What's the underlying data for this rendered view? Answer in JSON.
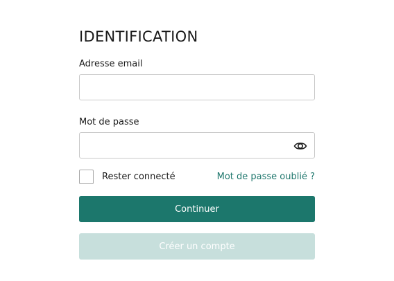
{
  "login": {
    "title": "IDENTIFICATION",
    "email_label": "Adresse email",
    "email_value": "",
    "password_label": "Mot de passe",
    "password_value": "",
    "show_password_icon": "eye-icon",
    "remember_label": "Rester connecté",
    "remember_checked": false,
    "forgot_link": "Mot de passe oublié ?",
    "continue_button": "Continuer",
    "create_account_button": "Créer un compte"
  },
  "colors": {
    "primary": "#1c776c",
    "primary_light": "#c7dfdc",
    "link": "#1f776d",
    "input_border": "#c9c9c9",
    "text": "#1a1a1a"
  }
}
